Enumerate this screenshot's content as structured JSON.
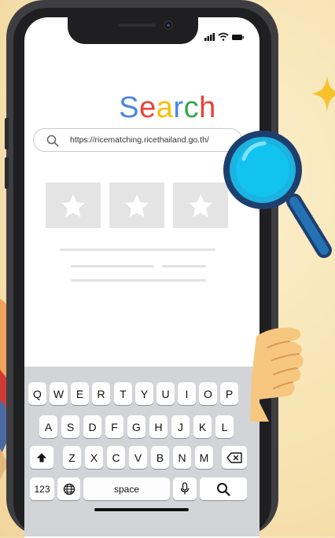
{
  "search": {
    "title_letters": [
      "S",
      "e",
      "a",
      "r",
      "c",
      "h"
    ],
    "title_colors": [
      "#4a86e8",
      "#ea4335",
      "#fbbc05",
      "#4a86e8",
      "#34a853",
      "#ea4335"
    ],
    "url": "https://ricematching.ricethailand.go.th/"
  },
  "results": {
    "tiles": [
      "star-icon",
      "star-icon",
      "star-icon"
    ]
  },
  "keyboard": {
    "row1": [
      "Q",
      "W",
      "E",
      "R",
      "T",
      "Y",
      "U",
      "I",
      "O",
      "P"
    ],
    "row2": [
      "A",
      "S",
      "D",
      "F",
      "G",
      "H",
      "J",
      "K",
      "L"
    ],
    "row3": [
      "Z",
      "X",
      "C",
      "V",
      "B",
      "N",
      "M"
    ],
    "numbers_label": "123",
    "space_label": "space"
  },
  "colors": {
    "background": "#f7e3b2",
    "phone": "#3e3e42",
    "magnifier_lens": "#1bb3e0",
    "magnifier_rim": "#1d3f6e",
    "sparkle": "#f8c22d"
  }
}
